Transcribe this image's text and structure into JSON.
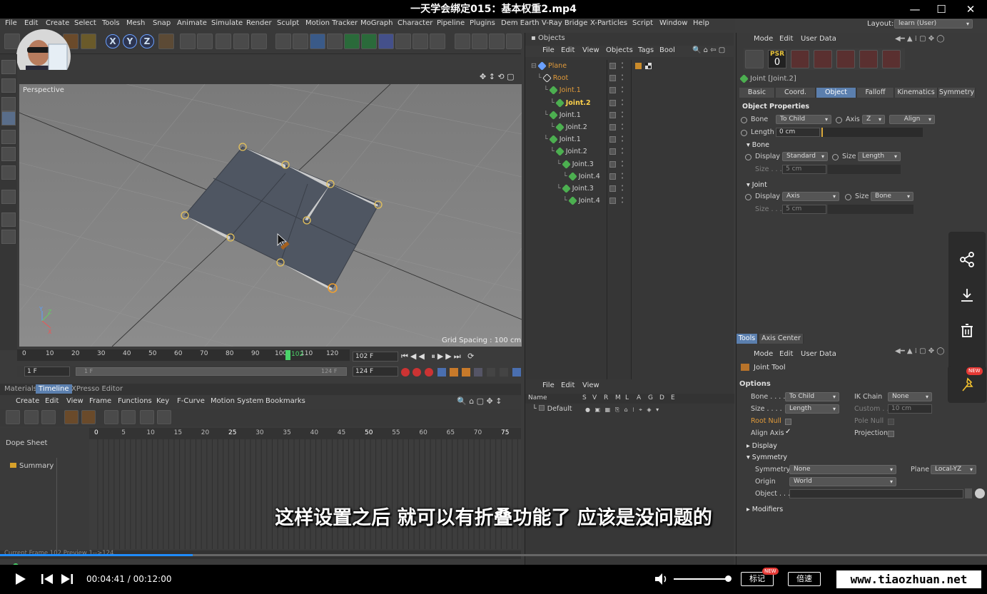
{
  "window": {
    "title": "一天学会绑定015：基本权重2.mp4",
    "minimize": "—",
    "maximize": "☐",
    "close": "✕"
  },
  "menu": [
    "File",
    "Edit",
    "Create",
    "Select",
    "Tools",
    "Mesh",
    "Snap",
    "Animate",
    "Simulate",
    "Render",
    "Sculpt",
    "Motion Tracker",
    "MoGraph",
    "Character",
    "Pipeline",
    "Plugins",
    "Dem Earth",
    "V-Ray Bridge",
    "X-Particles",
    "Script",
    "Window",
    "Help"
  ],
  "layout": {
    "label": "Layout:",
    "value": "learn (User)"
  },
  "toolbar": {
    "x": "X",
    "y": "Y",
    "z": "Z"
  },
  "viewport": {
    "label": "Perspective",
    "grid_spacing": "Grid Spacing : 100 cm"
  },
  "timeline_ruler": {
    "ticks": [
      "0",
      "10",
      "20",
      "30",
      "40",
      "50",
      "60",
      "70",
      "80",
      "90",
      "100",
      "110",
      "120"
    ],
    "current_marker": "102"
  },
  "frames": {
    "current": "102 F",
    "end": "124 F",
    "start": "1 F",
    "range_start": "1 F",
    "range_end": "124 F"
  },
  "lower_tabs": {
    "materials": "Materials",
    "timeline": "Timeline",
    "xpresso": "XPresso Editor"
  },
  "timeline_menu": [
    "Create",
    "Edit",
    "View",
    "Frame",
    "Functions",
    "Key",
    "F-Curve",
    "Motion System",
    "Bookmarks"
  ],
  "dope": {
    "title": "Dope Sheet",
    "summary": "Summary",
    "ticks": [
      "0",
      "5",
      "10",
      "15",
      "20",
      "25",
      "30",
      "35",
      "40",
      "45",
      "50",
      "55",
      "60",
      "65",
      "70",
      "75"
    ]
  },
  "status": {
    "text": "Current Frame  102  Preview  1-->124"
  },
  "objects": {
    "title": "Objects",
    "menu": [
      "File",
      "Edit",
      "View",
      "Objects",
      "Tags",
      "Bool"
    ],
    "tree": [
      {
        "name": "Plane",
        "indent": 0,
        "color": "#e09a3a"
      },
      {
        "name": "Root",
        "indent": 1,
        "color": "#e09a3a"
      },
      {
        "name": "Joint.1",
        "indent": 2,
        "color": "#e09a3a"
      },
      {
        "name": "Joint.2",
        "indent": 3,
        "color": "#ffd24a"
      },
      {
        "name": "Joint.1",
        "indent": 2,
        "color": "#cfcfcf"
      },
      {
        "name": "Joint.2",
        "indent": 3,
        "color": "#cfcfcf"
      },
      {
        "name": "Joint.1",
        "indent": 2,
        "color": "#cfcfcf"
      },
      {
        "name": "Joint.2",
        "indent": 3,
        "color": "#cfcfcf"
      },
      {
        "name": "Joint.3",
        "indent": 4,
        "color": "#cfcfcf"
      },
      {
        "name": "Joint.4",
        "indent": 5,
        "color": "#cfcfcf"
      },
      {
        "name": "Joint.3",
        "indent": 4,
        "color": "#cfcfcf"
      },
      {
        "name": "Joint.4",
        "indent": 5,
        "color": "#cfcfcf"
      }
    ]
  },
  "layers": {
    "menu": [
      "File",
      "Edit",
      "View"
    ],
    "cols": [
      "Name",
      "S",
      "V",
      "R",
      "M",
      "L",
      "A",
      "G",
      "D",
      "E"
    ],
    "default_row": "Default"
  },
  "attributes": {
    "menu": [
      "Mode",
      "Edit",
      "User Data"
    ],
    "psr": {
      "label": "PSR",
      "value": "0"
    },
    "object_title": "Joint [Joint.2]",
    "tabs": [
      "Basic",
      "Coord.",
      "Object",
      "Falloff",
      "Kinematics",
      "Symmetry"
    ],
    "active_tab": "Object",
    "section": "Object Properties",
    "bone_label": "Bone",
    "bone_value": "To Child",
    "axis_label": "Axis",
    "axis_value": "Z",
    "align": "Align",
    "length_label": "Length",
    "length_value": "0 cm",
    "bone_section": "Bone",
    "display_label": "Display",
    "display_value": "Standard",
    "size_label": "Size",
    "size_value": "Length",
    "size_field_label": "Size . . .",
    "size_field": "5 cm",
    "joint_section": "Joint",
    "jdisplay_value": "Axis",
    "jsize_value": "Bone",
    "jsize_field": "5 cm"
  },
  "tools": {
    "tabs": [
      "Tools",
      "Axis Center"
    ],
    "menu": [
      "Mode",
      "Edit",
      "User Data"
    ],
    "tool_title": "Joint Tool",
    "options": "Options",
    "bone_label": "Bone . . . .",
    "bone_value": "To Child",
    "ikchain_label": "IK Chain",
    "ikchain_value": "None",
    "size_label": "Size . . . .",
    "size_value": "Length",
    "custom_label": "Custom . .",
    "custom_value": "10 cm",
    "rootnull": "Root Null",
    "polenull": "Pole Null",
    "alignaxis": "Align Axis",
    "alignaxis_check": "✓",
    "projection": "Projection",
    "display_section": "Display",
    "symmetry_section": "Symmetry",
    "symmetry_label": "Symmetry",
    "symmetry_value": "None",
    "plane_label": "Plane",
    "plane_value": "Local-YZ",
    "origin_label": "Origin",
    "origin_value": "World",
    "object_label": "Object . . .",
    "modifiers_section": "Modifiers"
  },
  "subtitle": "这样设置之后 就可以有折叠功能了 应该是没问题的",
  "player": {
    "time": "00:04:41 / 00:12:00",
    "progress": 0.39,
    "volume": 1.0,
    "mark": "标记",
    "mark_badge": "NEW",
    "speed": "倍速"
  },
  "sidebar": {
    "new_badge": "NEW"
  },
  "watermark": "www.tiaozhuan.net"
}
